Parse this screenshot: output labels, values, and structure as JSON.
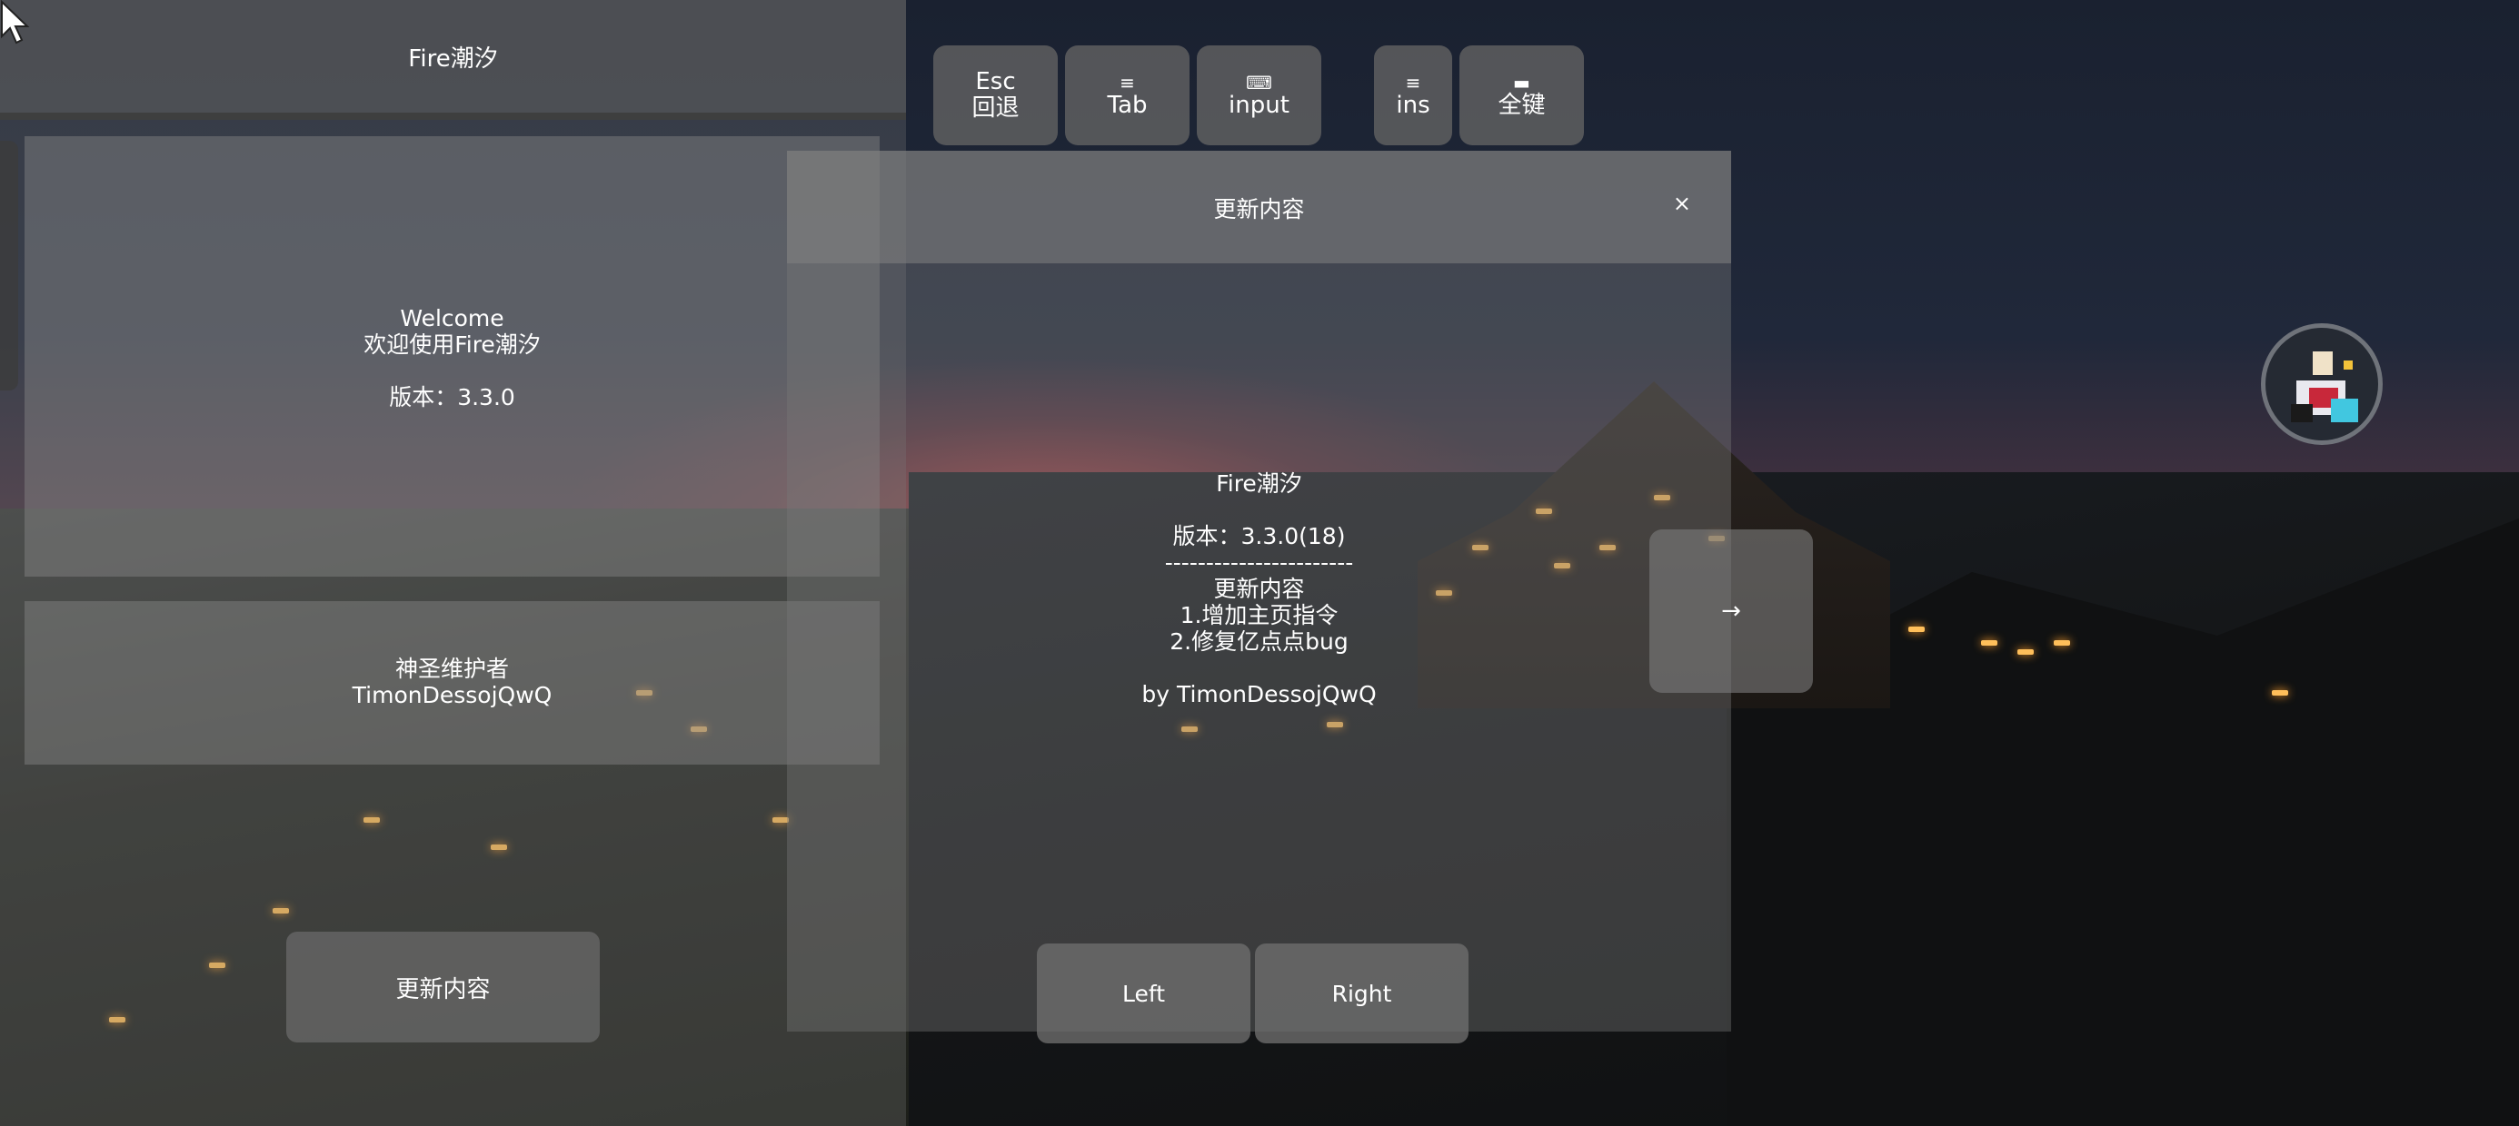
{
  "left_panel": {
    "title": "Fire潮汐",
    "welcome": {
      "line1": "Welcome",
      "line2": "欢迎使用Fire潮汐",
      "version": "版本：3.3.0"
    },
    "maintainer": {
      "line1": "神圣维护者",
      "line2": "TimonDessojQwQ"
    },
    "update_button": "更新内容"
  },
  "keybar": [
    {
      "icon": "",
      "top": "Esc",
      "bottom": "回退"
    },
    {
      "icon": "≡",
      "top": "",
      "bottom": "Tab"
    },
    {
      "icon": "⌨",
      "top": "",
      "bottom": "input"
    },
    {
      "icon": "≡",
      "top": "",
      "bottom": "ins"
    },
    {
      "icon": "▬",
      "top": "",
      "bottom": "全键"
    }
  ],
  "dialog": {
    "title": "更新内容",
    "close": "×",
    "app_name": "Fire潮汐",
    "version": "版本：3.3.0(18)",
    "separator": "-----------------------",
    "section_title": "更新内容",
    "items": [
      "1.增加主页指令",
      "2.修复亿点点bug"
    ],
    "author": "by TimonDessojQwQ",
    "left_button": "Left",
    "right_button": "Right"
  },
  "next_arrow": "→",
  "colors": {
    "panel": "#7a7a7a",
    "button": "#6a6a6a",
    "sunset": "#c84646"
  }
}
